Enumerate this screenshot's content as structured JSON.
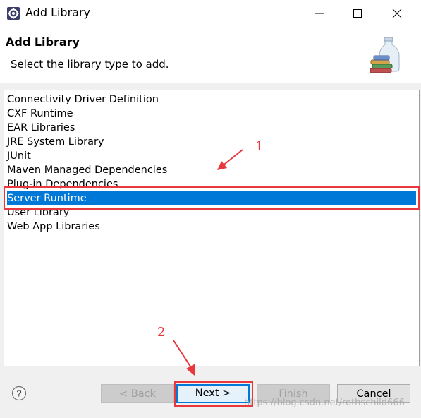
{
  "window": {
    "title": "Add Library"
  },
  "header": {
    "title": "Add Library",
    "description": "Select the library type to add."
  },
  "library_types": [
    {
      "label": "Connectivity Driver Definition",
      "selected": false
    },
    {
      "label": "CXF Runtime",
      "selected": false
    },
    {
      "label": "EAR Libraries",
      "selected": false
    },
    {
      "label": "JRE System Library",
      "selected": false
    },
    {
      "label": "JUnit",
      "selected": false
    },
    {
      "label": "Maven Managed Dependencies",
      "selected": false
    },
    {
      "label": "Plug-in Dependencies",
      "selected": false
    },
    {
      "label": "Server Runtime",
      "selected": true
    },
    {
      "label": "User Library",
      "selected": false
    },
    {
      "label": "Web App Libraries",
      "selected": false
    }
  ],
  "annotations": {
    "step1": "1",
    "step2": "2",
    "color": "#e8383d"
  },
  "buttons": {
    "back": "< Back",
    "next": "Next >",
    "finish": "Finish",
    "cancel": "Cancel"
  },
  "watermark": "https://blog.csdn.net/rothschild666",
  "colors": {
    "selection": "#0078d7",
    "annotation": "#e8383d"
  }
}
